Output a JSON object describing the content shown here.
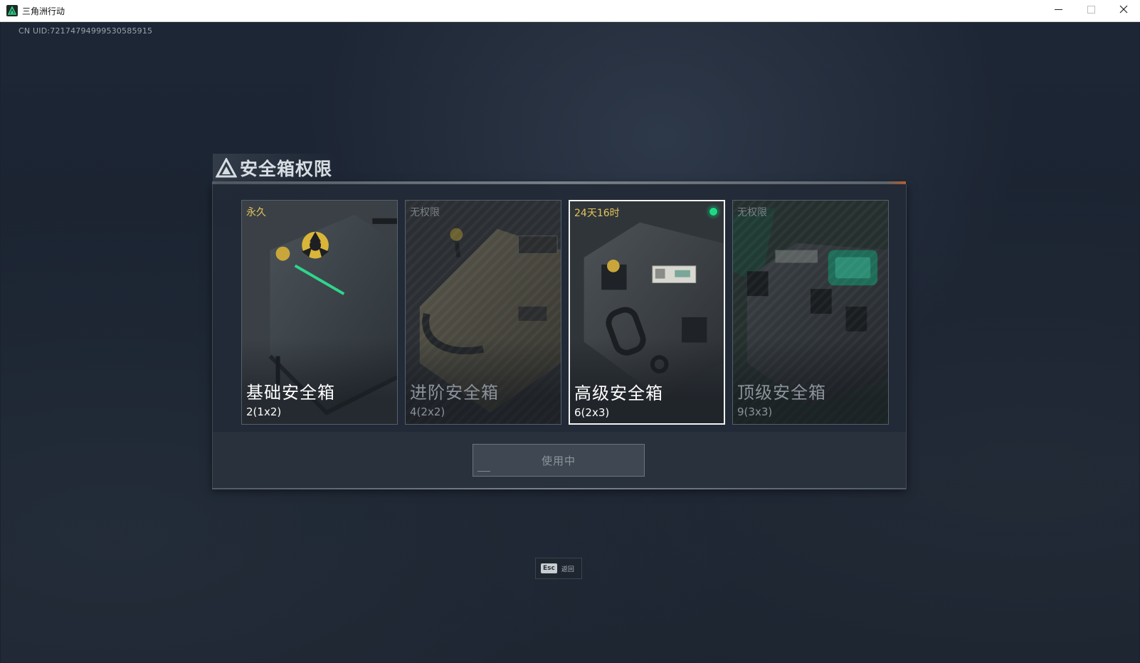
{
  "window": {
    "title": "三角洲行动",
    "minimize_icon": "minimize-icon",
    "maximize_icon": "maximize-icon",
    "close_icon": "close-icon"
  },
  "uid_text": "CN UID:72174794999530585915",
  "dialog": {
    "title": "安全箱权限",
    "title_icon": "delta-logo-icon",
    "cards": [
      {
        "status": "永久",
        "name": "基础安全箱",
        "capacity": "2(1x2)",
        "locked": false,
        "selected": false
      },
      {
        "status": "无权限",
        "name": "进阶安全箱",
        "capacity": "4(2x2)",
        "locked": true,
        "selected": false
      },
      {
        "status": "24天16时",
        "name": "高级安全箱",
        "capacity": "6(2x3)",
        "locked": false,
        "selected": true,
        "active_indicator": "green-dot-icon"
      },
      {
        "status": "无权限",
        "name": "顶级安全箱",
        "capacity": "9(3x3)",
        "locked": true,
        "selected": false
      }
    ],
    "action_button": "使用中"
  },
  "esc_hint": {
    "key": "Esc",
    "label": "返回"
  },
  "colors": {
    "status_gold": "#e4c35b",
    "active_green": "#20d884",
    "accent_orange": "#c76a36"
  }
}
